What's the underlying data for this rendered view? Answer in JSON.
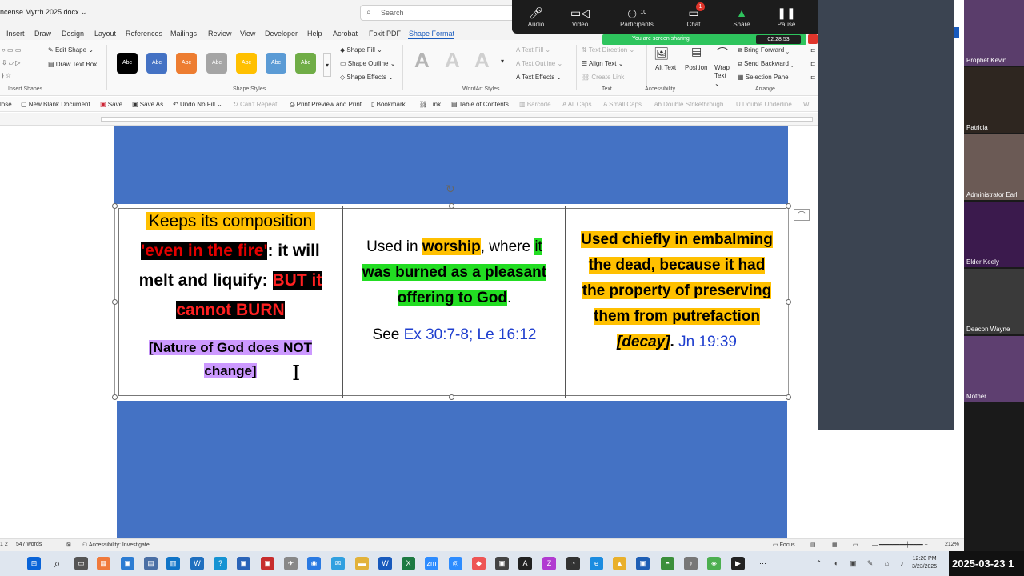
{
  "window": {
    "doc_title": "ncense Myrrh 2025.docx ⌄",
    "search_placeholder": "Search"
  },
  "tabs": [
    "Insert",
    "Draw",
    "Design",
    "Layout",
    "References",
    "Mailings",
    "Review",
    "View",
    "Developer",
    "Help",
    "Acrobat",
    "Foxit PDF",
    "Shape Format"
  ],
  "active_tab": "Shape Format",
  "ribbon": {
    "insert_shapes": {
      "edit_shape": "Edit Shape ⌄",
      "draw_text_box": "Draw Text Box",
      "group": "Insert Shapes"
    },
    "shape_styles": {
      "swatch_label": "Abc",
      "shape_fill": "Shape Fill ⌄",
      "shape_outline": "Shape Outline ⌄",
      "shape_effects": "Shape Effects ⌄",
      "group": "Shape Styles"
    },
    "wordart": {
      "letter": "A",
      "text_fill": "Text Fill ⌄",
      "text_outline": "Text Outline ⌄",
      "text_effects": "Text Effects ⌄",
      "group": "WordArt Styles"
    },
    "text": {
      "text_direction": "Text Direction ⌄",
      "align_text": "Align Text ⌄",
      "create_link": "Create Link",
      "group": "Text"
    },
    "accessibility": {
      "alt_text": "Alt Text",
      "group": "Accessibility"
    },
    "arrange": {
      "position": "Position",
      "wrap_text": "Wrap Text ⌄",
      "bring_forward": "Bring Forward ⌄",
      "send_backward": "Send Backward ⌄",
      "selection_pane": "Selection Pane",
      "group": "Arrange"
    }
  },
  "quick_access": [
    "lose",
    "New Blank Document",
    "Save",
    "Save As",
    "Undo No Fill",
    "Can't Repeat",
    "Print Preview and Print",
    "Bookmark",
    "Link",
    "Table of Contents",
    "Barcode",
    "All Caps",
    "Small Caps",
    "Double Strikethrough",
    "Double Underline",
    "W"
  ],
  "table": {
    "col1": {
      "line1": "Keeps its composition",
      "line2_hl": "'even in the fire'",
      "line2_rest": ": it will",
      "line3": "melt and liquify: ",
      "line3_hl": "BUT it",
      "line4_hl": "cannot BURN",
      "note1": "[Nature of God does NOT",
      "note2": "change]"
    },
    "col2": {
      "pre": "Used in ",
      "worship": "worship",
      "mid": ", where ",
      "hl1": "it",
      "hl2": "was burned as a pleasant",
      "hl3": "offering to God",
      "period": ".",
      "see": "See ",
      "refs": "Ex 30:7-8; Le 16:12"
    },
    "col3": {
      "l1": "Used chiefly in embalming",
      "l2": "the dead, because it had",
      "l3": "the property of preserving",
      "l4": "them from putrefaction",
      "l5_hl": "[decay]",
      "l5_dot": ".",
      "l5_ref": " Jn 19:39"
    }
  },
  "status_bar": {
    "page": "1 2",
    "words": "547 words",
    "accessibility": "Accessibility: Investigate",
    "focus": "Focus",
    "zoom": "212%"
  },
  "zoom_controls": {
    "buttons": [
      "Audio",
      "Video",
      "Participants",
      "Chat",
      "Share",
      "Pause"
    ],
    "participants_count": "10",
    "chat_badge": "1",
    "sharing_msg": "You are screen sharing",
    "timer": "02:28:53"
  },
  "participants": [
    "Prophet Kevin",
    "Patricia",
    "Administrator Earl",
    "Elder Keely",
    "Deacon Wayne",
    "Mother"
  ],
  "clock": {
    "time": "12:20 PM",
    "date": "3/23/2025"
  },
  "datestamp": "2025-03-23 1",
  "colors": {
    "accent": "#185abd",
    "shape_blue": "#4472c4",
    "highlight_yellow": "#ffc000",
    "highlight_green": "#22dd22",
    "highlight_purple": "#cc99ff",
    "zoom_green": "#2ec45d"
  }
}
